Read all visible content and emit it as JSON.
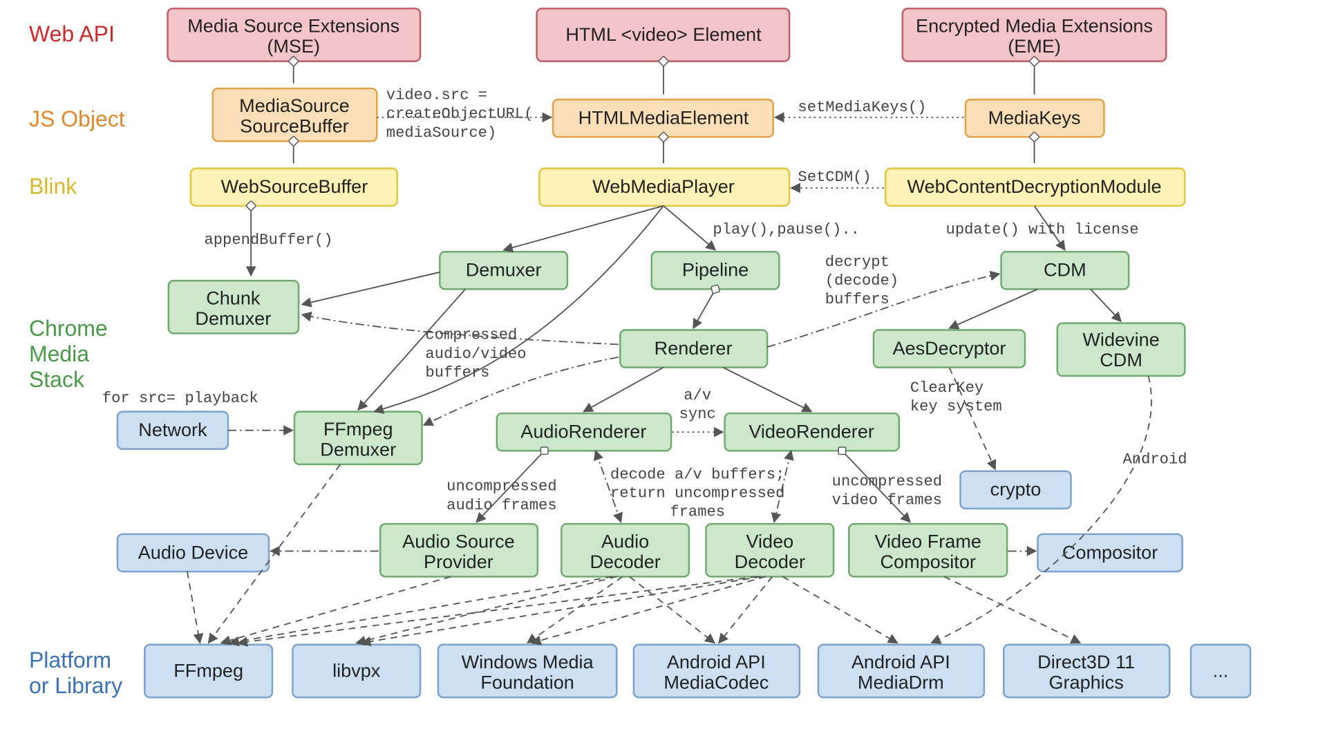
{
  "layers": {
    "webapi": "Web API",
    "jsobject": "JS Object",
    "blink": "Blink",
    "chrome1": "Chrome",
    "chrome2": "Media",
    "chrome3": "Stack",
    "platform1": "Platform",
    "platform2": "or Library"
  },
  "boxes": {
    "mse1": "Media Source Extensions",
    "mse2": "(MSE)",
    "video": "HTML <video> Element",
    "eme1": "Encrypted Media Extensions",
    "eme2": "(EME)",
    "mssb1": "MediaSource",
    "mssb2": "SourceBuffer",
    "htmlme": "HTMLMediaElement",
    "mkeys": "MediaKeys",
    "wsb": "WebSourceBuffer",
    "wmp": "WebMediaPlayer",
    "wcdm": "WebContentDecryptionModule",
    "chunk1": "Chunk",
    "chunk2": "Demuxer",
    "demux": "Demuxer",
    "pipeline": "Pipeline",
    "cdm": "CDM",
    "renderer": "Renderer",
    "aesdec": "AesDecryptor",
    "wvcdm1": "Widevine",
    "wvcdm2": "CDM",
    "ffdem1": "FFmpeg",
    "ffdem2": "Demuxer",
    "arend": "AudioRenderer",
    "vrend": "VideoRenderer",
    "asp1": "Audio Source",
    "asp2": "Provider",
    "adec1": "Audio",
    "adec2": "Decoder",
    "vdec1": "Video",
    "vdec2": "Decoder",
    "vfc1": "Video Frame",
    "vfc2": "Compositor",
    "network": "Network",
    "crypto": "crypto",
    "adev": "Audio Device",
    "compositor": "Compositor",
    "ffmpeg": "FFmpeg",
    "libvpx": "libvpx",
    "wmf1": "Windows Media",
    "wmf2": "Foundation",
    "amc1": "Android API",
    "amc2": "MediaCodec",
    "amd1": "Android API",
    "amd2": "MediaDrm",
    "d3d1": "Direct3D 11",
    "d3d2": "Graphics",
    "dots": "..."
  },
  "labels": {
    "createURL1": "video.src =",
    "createURL2": "createObjectURL(",
    "createURL3": "mediaSource)",
    "setMediaKeys": "setMediaKeys()",
    "setCDM": "SetCDM()",
    "appendBuffer": "appendBuffer()",
    "playpause": "play(),pause()..",
    "updateLicense": "update() with license",
    "decrypt1": "decrypt",
    "decrypt2": "(decode)",
    "decrypt3": "buffers",
    "srcplay": "for src= playback",
    "compbuf1": "compressed",
    "compbuf2": "audio/video",
    "compbuf3": "buffers",
    "avsync1": "a/v",
    "avsync2": "sync",
    "clearkey1": "ClearKey",
    "clearkey2": "key system",
    "android": "Android",
    "uaf1": "uncompressed",
    "uaf2": "audio frames",
    "decret1": "decode a/v buffers;",
    "decret2": "return uncompressed",
    "decret3": "frames",
    "uvf1": "uncompressed",
    "uvf2": "video frames"
  }
}
